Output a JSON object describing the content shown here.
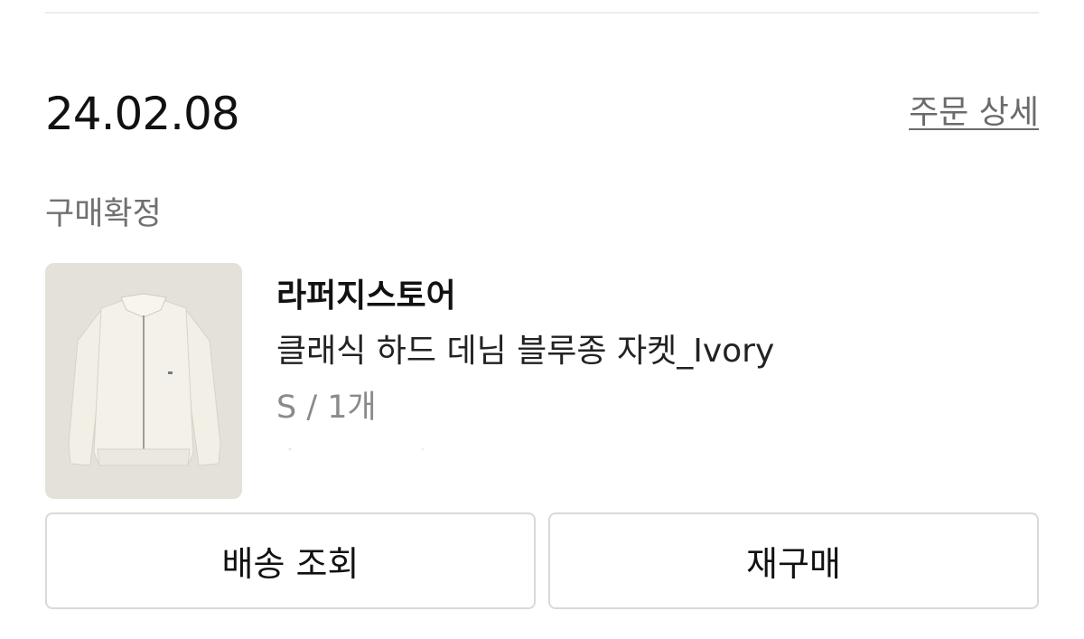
{
  "order": {
    "date": "24.02.08",
    "detail_link": "주문 상세",
    "status": "구매확정"
  },
  "product": {
    "image_icon": "ivory-jacket-photo",
    "store": "라퍼지스토어",
    "name": "클래식 하드 데님 블루종 자켓_Ivory",
    "option": "S / 1개"
  },
  "actions": {
    "track_delivery": "배송 조회",
    "reorder": "재구매"
  },
  "colors": {
    "divider": "#ececec",
    "status_text": "#707070",
    "link_text": "#6b6b6b",
    "option_text": "#8a8a8a",
    "button_border": "#d9d9d9"
  }
}
